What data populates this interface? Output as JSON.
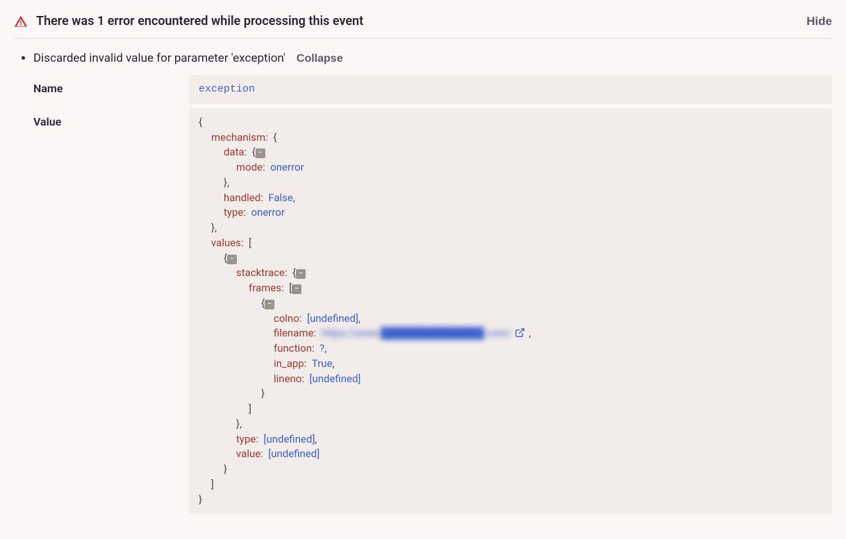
{
  "header": {
    "title": "There was 1 error encountered while processing this event",
    "hide_label": "Hide"
  },
  "error": {
    "message": "Discarded invalid value for parameter 'exception'",
    "collapse_label": "Collapse",
    "name_label": "Name",
    "value_label": "Value",
    "name_value": "exception"
  },
  "code": {
    "brace_open": "{",
    "brace_close": "}",
    "bracket_open": "[",
    "bracket_close": "]",
    "colon": ":",
    "comma": ",",
    "minus": "-",
    "k_mechanism": "mechanism",
    "k_data": "data",
    "k_mode": "mode",
    "v_onerror": "onerror",
    "k_handled": "handled",
    "v_false": "False",
    "k_type": "type",
    "k_values": "values",
    "k_stacktrace": "stacktrace",
    "k_frames": "frames",
    "k_colno": "colno",
    "v_undefined": "[undefined]",
    "k_filename": "filename",
    "v_filename_url": "https://www.██████████████.com/",
    "k_function": "function",
    "v_question": "?",
    "k_in_app": "in_app",
    "v_true": "True",
    "k_lineno": "lineno",
    "k_value": "value"
  }
}
